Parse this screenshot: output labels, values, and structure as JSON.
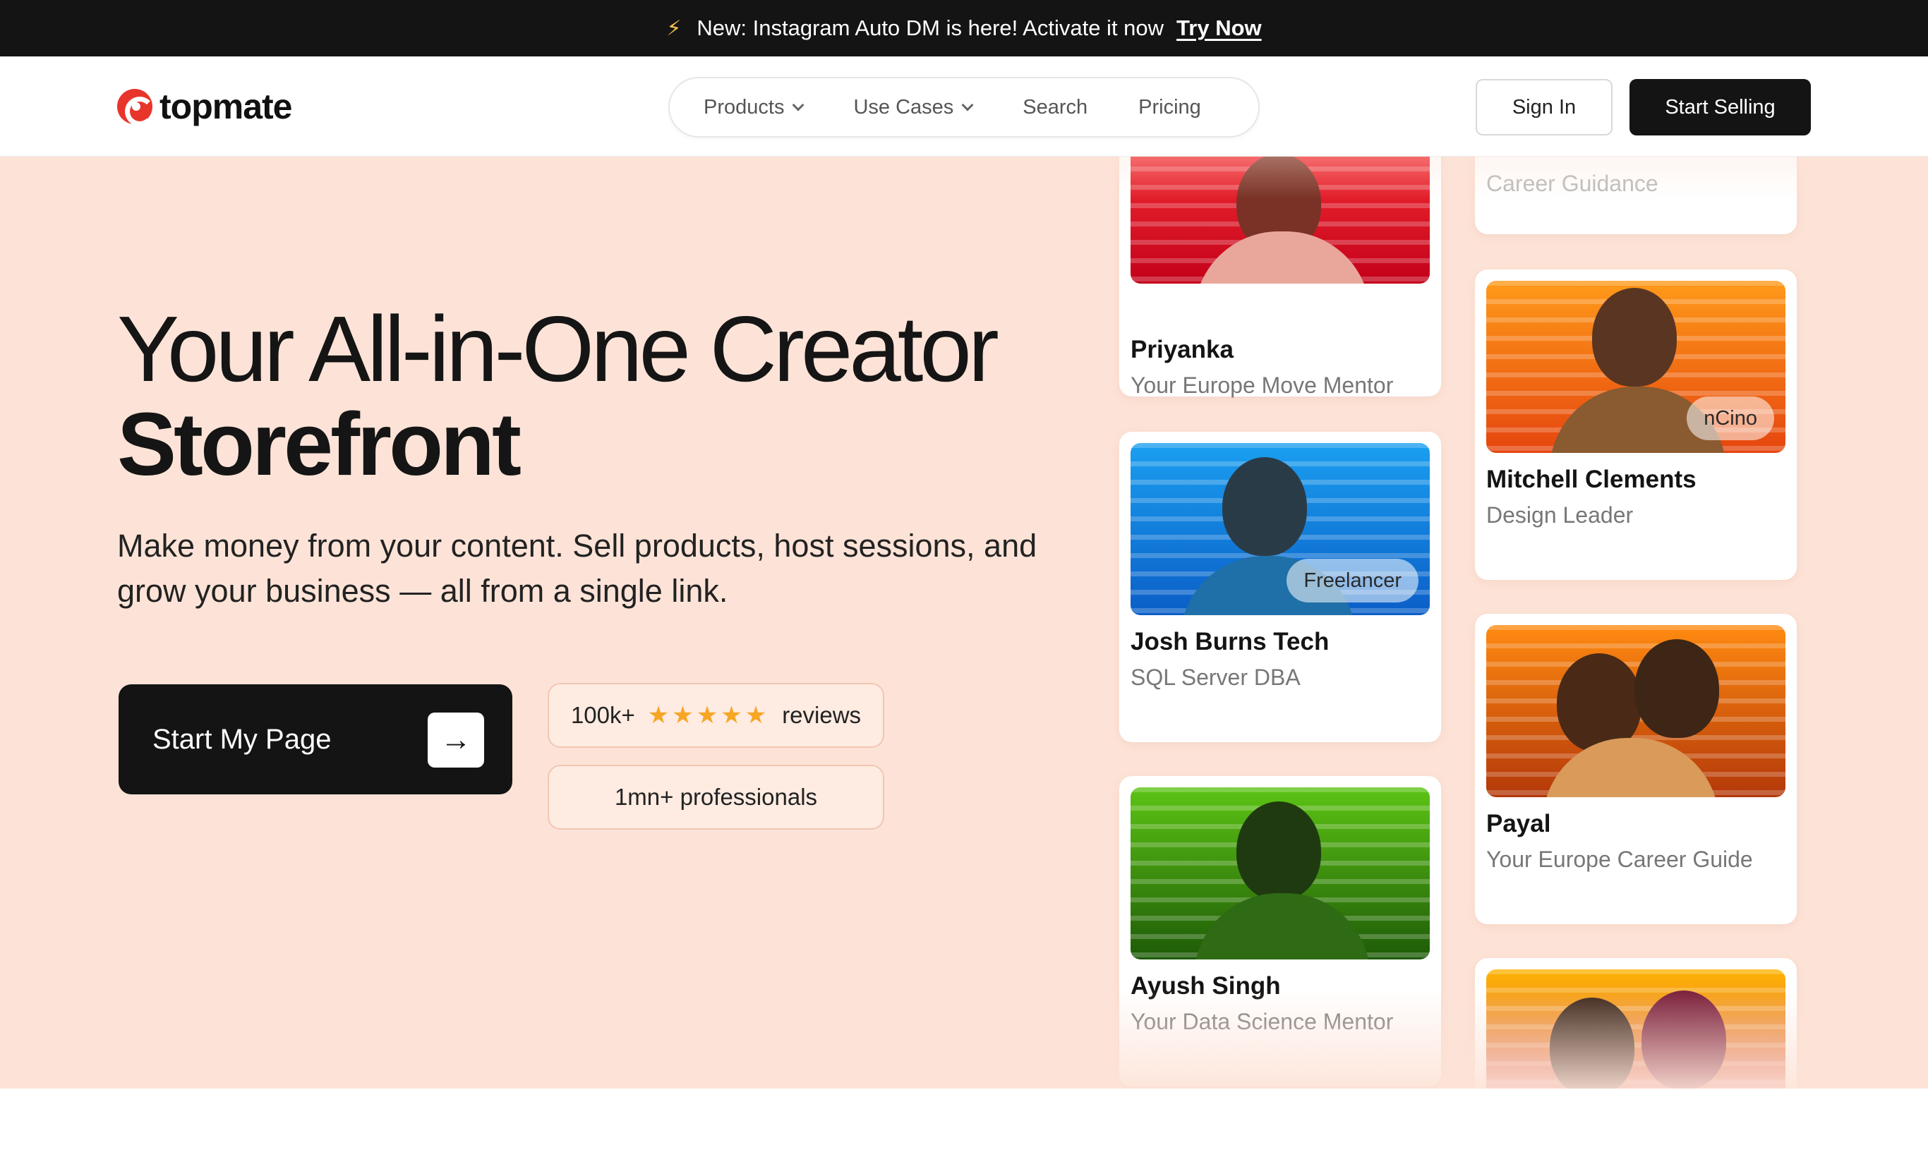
{
  "announcement": {
    "icon": "lightning-icon",
    "text": "New: Instagram Auto DM is here! Activate it now",
    "link_label": "Try Now"
  },
  "header": {
    "logo_text": "topmate",
    "nav": [
      {
        "label": "Products",
        "has_dropdown": true
      },
      {
        "label": "Use Cases",
        "has_dropdown": true
      },
      {
        "label": "Search",
        "has_dropdown": false
      },
      {
        "label": "Pricing",
        "has_dropdown": false
      }
    ],
    "sign_in_label": "Sign In",
    "start_selling_label": "Start Selling"
  },
  "hero": {
    "headline_line1": "Your All-in-One Creator",
    "headline_line2": "Storefront",
    "subtext": "Make money from your content. Sell products, host sessions, and grow your business — all from a single link.",
    "cta_label": "Start My Page",
    "cta_icon": "arrow-right-icon",
    "reviews_count": "100k+",
    "reviews_rating": 5,
    "reviews_label": "reviews",
    "professionals_label": "1mn+ professionals"
  },
  "colors": {
    "hero_bg": "#fde3d7",
    "dark": "#141414",
    "brand_red": "#e8352b",
    "star": "#f6a623"
  },
  "creators": {
    "col1": [
      {
        "name": "Priyanka",
        "role": "Your Europe Move Mentor",
        "tag": ""
      },
      {
        "name": "Josh Burns Tech",
        "role": "SQL Server DBA",
        "tag": "Freelancer"
      },
      {
        "name": "Ayush Singh",
        "role": "Your Data Science Mentor",
        "tag": ""
      }
    ],
    "col2": [
      {
        "name": "",
        "role": "Career Guidance",
        "tag": ""
      },
      {
        "name": "Mitchell Clements",
        "role": "Design Leader",
        "tag": "nCino"
      },
      {
        "name": "Payal",
        "role": "Your Europe Career Guide",
        "tag": ""
      },
      {
        "name": "",
        "role": "",
        "tag": ""
      }
    ]
  }
}
